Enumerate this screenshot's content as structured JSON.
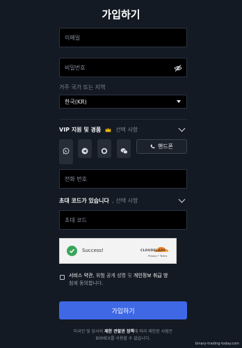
{
  "title": "가입하기",
  "email": {
    "placeholder": "이메일"
  },
  "password": {
    "placeholder": "비밀번호"
  },
  "country": {
    "label": "거주 국가 또는 지역",
    "value": "한국(KR)"
  },
  "vip": {
    "label": "VIP 지원 및 경품",
    "optional": "선택 사항"
  },
  "phone": {
    "button_label": "핸드폰",
    "placeholder": "전화 번호"
  },
  "referral": {
    "label": "초대 코드가 있습니다",
    "optional": "선택 사항",
    "placeholder": "초대 코드"
  },
  "captcha": {
    "status": "Success!",
    "brand": "CLOUDFLARE",
    "links": "Privacy • Terms",
    "success_color": "#3aa55a"
  },
  "terms": {
    "line1_a": "서비스 약관",
    "line1_b": ", 위험 공개 성명 ",
    "line1_c": "및",
    "line1_d": " 개인정보 취급 방",
    "line2": "침에 동의합니다."
  },
  "submit_label": "가입하기",
  "footer": {
    "a": "미국인 및 당사의 ",
    "b": "제한 관할권 정책",
    "c": "에 따라 제한된 사람은",
    "line2": "BitMEX를 사용할 수 없습니다."
  },
  "watermark": "binary-trading-today.com",
  "colors": {
    "accent": "#3f68e5",
    "background": "#141a23"
  },
  "icons": [
    "whatsapp-icon",
    "telegram-icon",
    "signal-icon",
    "wechat-icon",
    "phone-icon",
    "eye-off-icon",
    "crown-icon"
  ]
}
